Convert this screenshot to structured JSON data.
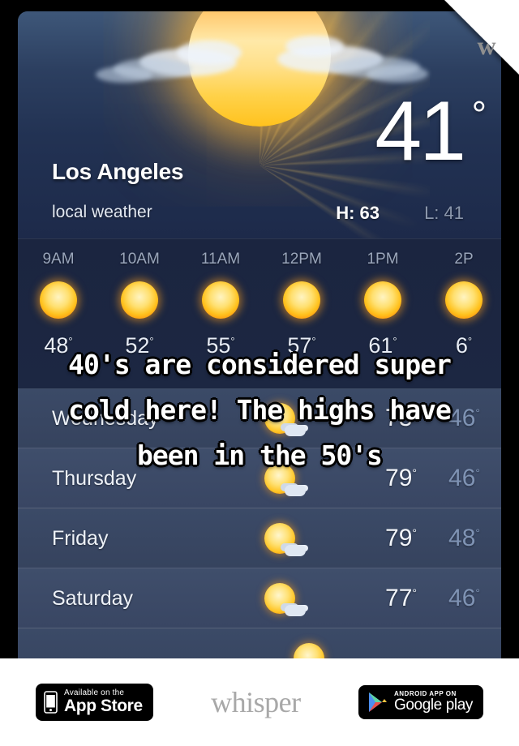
{
  "corner": {
    "logo_letter": "w"
  },
  "weather": {
    "city": "Los Angeles",
    "subtitle": "local weather",
    "current_temp": "41",
    "degree": "°",
    "high_label": "H: 63",
    "low_label": "L: 41",
    "hourly": [
      {
        "time": "9AM",
        "temp": "48",
        "icon": "sun-icon"
      },
      {
        "time": "10AM",
        "temp": "52",
        "icon": "sun-icon"
      },
      {
        "time": "11AM",
        "temp": "55",
        "icon": "sun-icon"
      },
      {
        "time": "12PM",
        "temp": "57",
        "icon": "sun-icon"
      },
      {
        "time": "1PM",
        "temp": "61",
        "icon": "sun-icon"
      },
      {
        "time": "2P",
        "temp": "6",
        "icon": "sun-icon"
      }
    ],
    "daily": [
      {
        "day": "Wednesday",
        "icon": "partly-sunny-icon",
        "high": "73",
        "low": "46"
      },
      {
        "day": "Thursday",
        "icon": "partly-sunny-icon",
        "high": "79",
        "low": "46"
      },
      {
        "day": "Friday",
        "icon": "partly-sunny-icon",
        "high": "79",
        "low": "48"
      },
      {
        "day": "Saturday",
        "icon": "partly-sunny-icon",
        "high": "77",
        "low": "46"
      }
    ]
  },
  "caption": {
    "text": "40's are considered super\ncold here! The highs have\nbeen in the 50's"
  },
  "footer": {
    "appstore": {
      "line1": "Available on the",
      "line2": "App Store"
    },
    "wordmark": "whisper",
    "googleplay": {
      "line1": "ANDROID APP ON",
      "line2": "Google play"
    }
  }
}
